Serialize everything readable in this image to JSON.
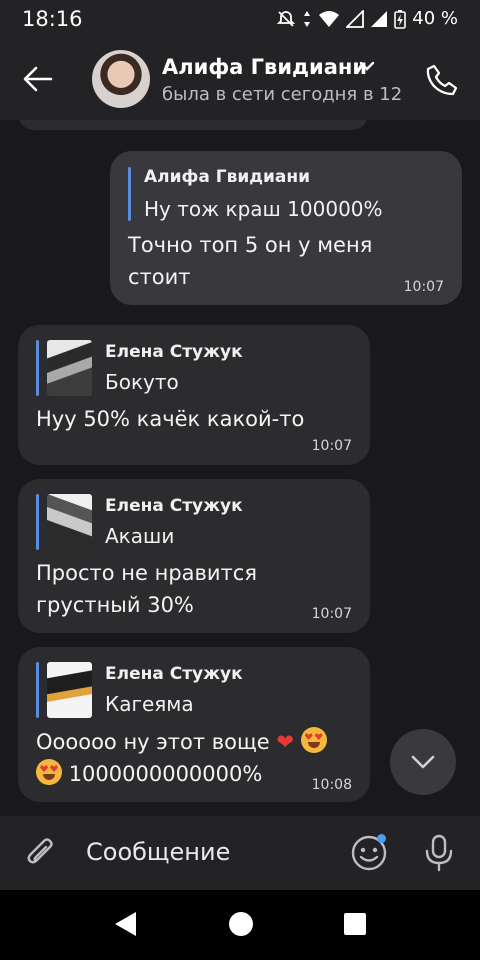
{
  "status_bar": {
    "time": "18:16",
    "battery": "40 %"
  },
  "header": {
    "contact_name": "Алифа Гвидиани",
    "contact_status": "была в сети сегодня в 12"
  },
  "messages": [
    {
      "direction": "outgoing",
      "reply_author": "Алифа Гвидиани",
      "reply_text": "Ну тож краш 100000%",
      "text_lines": [
        "Точно топ 5 он у меня",
        "стоит"
      ],
      "time": "10:07"
    },
    {
      "direction": "incoming",
      "reply_author": "Елена Стужук",
      "reply_text": "Бокуто",
      "text_lines": [
        "Нуу 50% качёк какой-то"
      ],
      "time": "10:07"
    },
    {
      "direction": "incoming",
      "reply_author": "Елена Стужук",
      "reply_text": "Акаши",
      "text_lines": [
        "Просто не нравится",
        "грустный 30%"
      ],
      "time": "10:07"
    },
    {
      "direction": "incoming",
      "reply_author": "Елена Стужук",
      "reply_text": "Кагеяма",
      "text_line1": "Оооооо ну этот воще",
      "text_line2": "1000000000000%",
      "time": "10:08"
    }
  ],
  "composer": {
    "placeholder": "Сообщение"
  },
  "icons": {
    "back": "arrow-left-icon",
    "call": "phone-icon",
    "attach": "paperclip-icon",
    "sticker": "smile-icon",
    "mic": "microphone-icon",
    "scroll": "chevron-down-icon"
  },
  "colors": {
    "background": "#19191b",
    "bar": "#232326",
    "incoming_bubble": "#2c2c2f",
    "outgoing_bubble": "#39393d",
    "reply_accent": "#5a8de0",
    "notification_dot": "#4a9ff5"
  }
}
